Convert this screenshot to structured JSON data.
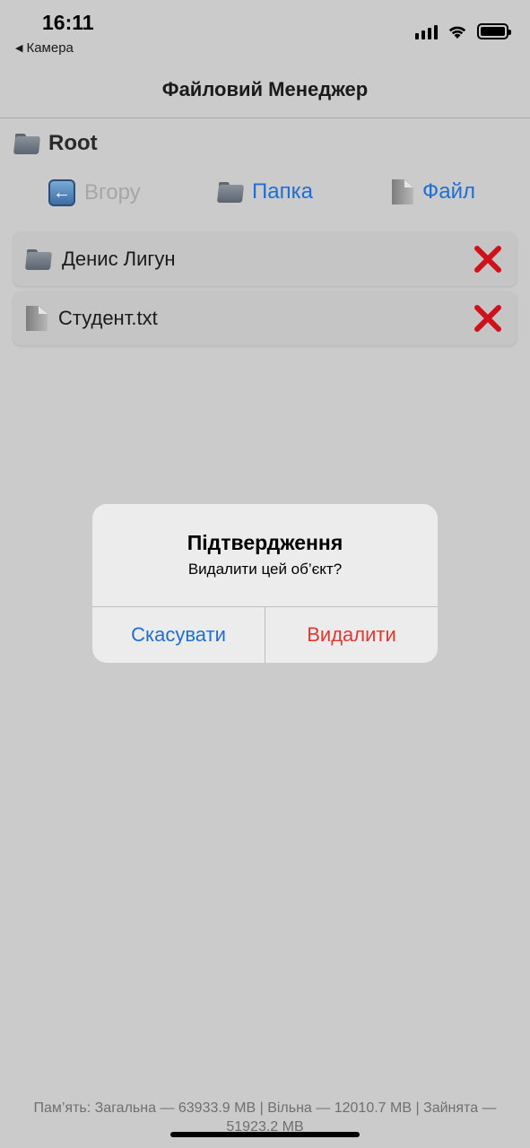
{
  "status_bar": {
    "time": "16:11",
    "back_label": "Камера",
    "back_icon": "back-triangle-icon",
    "icons": [
      "cellular-signal-icon",
      "wifi-icon",
      "battery-icon"
    ]
  },
  "nav": {
    "title": "Файловий Менеджер"
  },
  "path": {
    "label": "Root",
    "icon": "folder-icon"
  },
  "toolbar": {
    "up_label": "Вгору",
    "folder_label": "Папка",
    "file_label": "Файл"
  },
  "items": [
    {
      "label": "Денис Лигун",
      "type": "folder",
      "icon": "folder-icon",
      "action_icon": "delete-x-icon"
    },
    {
      "label": "Студент.txt",
      "type": "file",
      "icon": "file-icon",
      "action_icon": "delete-x-icon"
    }
  ],
  "dialog": {
    "title": "Підтвердження",
    "message": "Видалити цей об’єкт?",
    "cancel_label": "Скасувати",
    "confirm_label": "Видалити"
  },
  "footer": {
    "memory": "Пам’ять: Загальна — 63933.9 MB | Вільна — 12010.7 MB | Зайнята — 51923.2 MB"
  },
  "colors": {
    "accent": "#1e6fd4",
    "destructive": "#e0382e",
    "delete_x": "#d0111b",
    "background": "#cbcbcb",
    "disabled": "#a6a6a6"
  }
}
